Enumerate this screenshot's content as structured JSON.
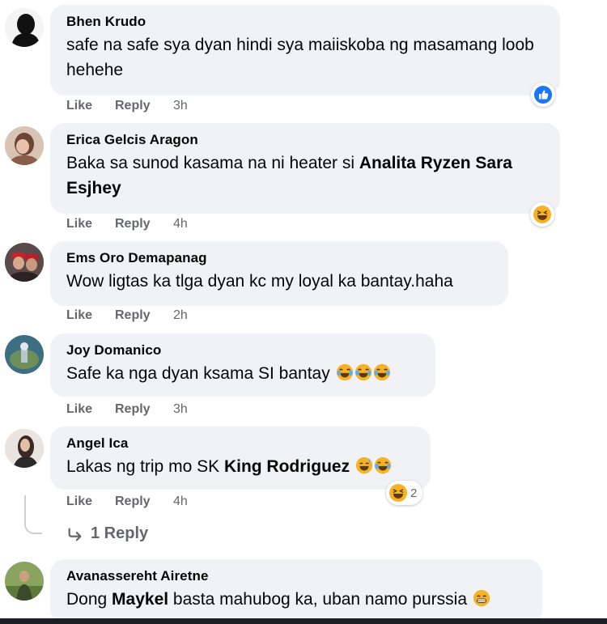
{
  "comments": [
    {
      "author": "Bhen Krudo",
      "text": "safe na safe sya dyan hindi sya maiiskoba ng masamang loob hehehe",
      "like": "Like",
      "reply": "Reply",
      "time": "3h",
      "reaction": "like"
    },
    {
      "author": "Erica Gelcis Aragon",
      "text_before": "Baka sa sunod kasama na ni heater si ",
      "mention": "Analita Ryzen Sara Esjhey",
      "like": "Like",
      "reply": "Reply",
      "time": "4h",
      "reaction": "haha"
    },
    {
      "author": "Ems Oro Demapanag",
      "text": "Wow ligtas ka tlga dyan kc my loyal ka bantay.haha",
      "like": "Like",
      "reply": "Reply",
      "time": "2h"
    },
    {
      "author": "Joy Domanico",
      "text": "Safe ka nga dyan ksama SI bantay",
      "like": "Like",
      "reply": "Reply",
      "time": "3h",
      "inline_emojis": [
        "joy",
        "joy",
        "joy"
      ]
    },
    {
      "author": "Angel Ica",
      "text_before": "Lakas ng trip mo SK ",
      "mention": "King Rodriguez",
      "like": "Like",
      "reply": "Reply",
      "time": "4h",
      "inline_emojis": [
        "sweat-smile",
        "joy"
      ],
      "reaction": "haha",
      "reaction_count": "2"
    },
    {
      "author": "Avanassereht Airetne",
      "text_before": "Dong ",
      "mention": "Maykel",
      "text_after": " basta mahubog ka, uban namo purssia",
      "inline_emojis": [
        "grin"
      ]
    }
  ],
  "replies_link": "1 Reply",
  "colors": {
    "bubble": "#f0f2f5",
    "meta": "#65676b",
    "like_blue": "#1877f2",
    "haha_yellow": "#f7b125"
  }
}
